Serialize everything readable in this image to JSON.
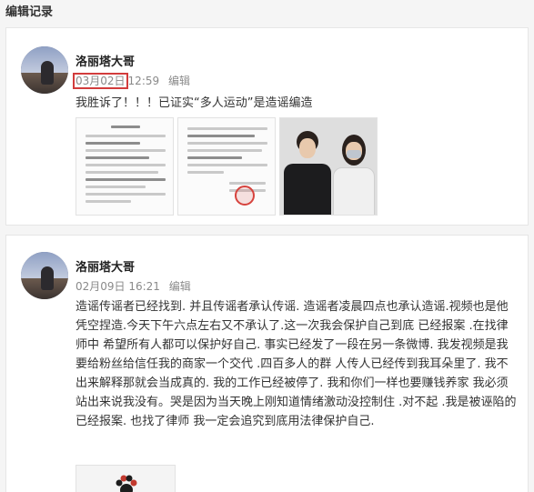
{
  "page": {
    "title": "编辑记录"
  },
  "entries": [
    {
      "author": "洛丽塔大哥",
      "date": "03月02日",
      "time": "12:59",
      "edit_label": "编辑",
      "text": "我胜诉了！！！已证实“多人运动”是造谣编造",
      "images": [
        "document-image",
        "document-image",
        "photo-image"
      ]
    },
    {
      "author": "洛丽塔大哥",
      "datetime": "02月09日 16:21",
      "edit_label": "编辑",
      "text": "造谣传谣者已经找到. 并且传谣者承认传谣. 造谣者凌晨四点也承认造谣.视频也是他凭空捏造.今天下午六点左右又不承认了.这一次我会保护自己到底 已经报案 .在找律师中 希望所有人都可以保护好自己. 事实已经发了一段在另一条微博. 我发视频是我要给粉丝给信任我的商家一个交代 .四百多人的群 人传人已经传到我耳朵里了. 我不出来解释那就会当成真的. 我的工作已经被停了. 我和你们一样也要赚钱养家 我必须站出来说我没有。哭是因为当天晚上刚知道情绪激动没控制住 .对不起 .我是被诬陷的已经报案. 也找了律师 我一定会追究到底用法律保护自己.",
      "images": [
        "photo-image"
      ]
    }
  ],
  "colors": {
    "highlight_border": "#d23c3c",
    "meta_text": "#8a8a8a",
    "background": "#f5f5f5"
  }
}
